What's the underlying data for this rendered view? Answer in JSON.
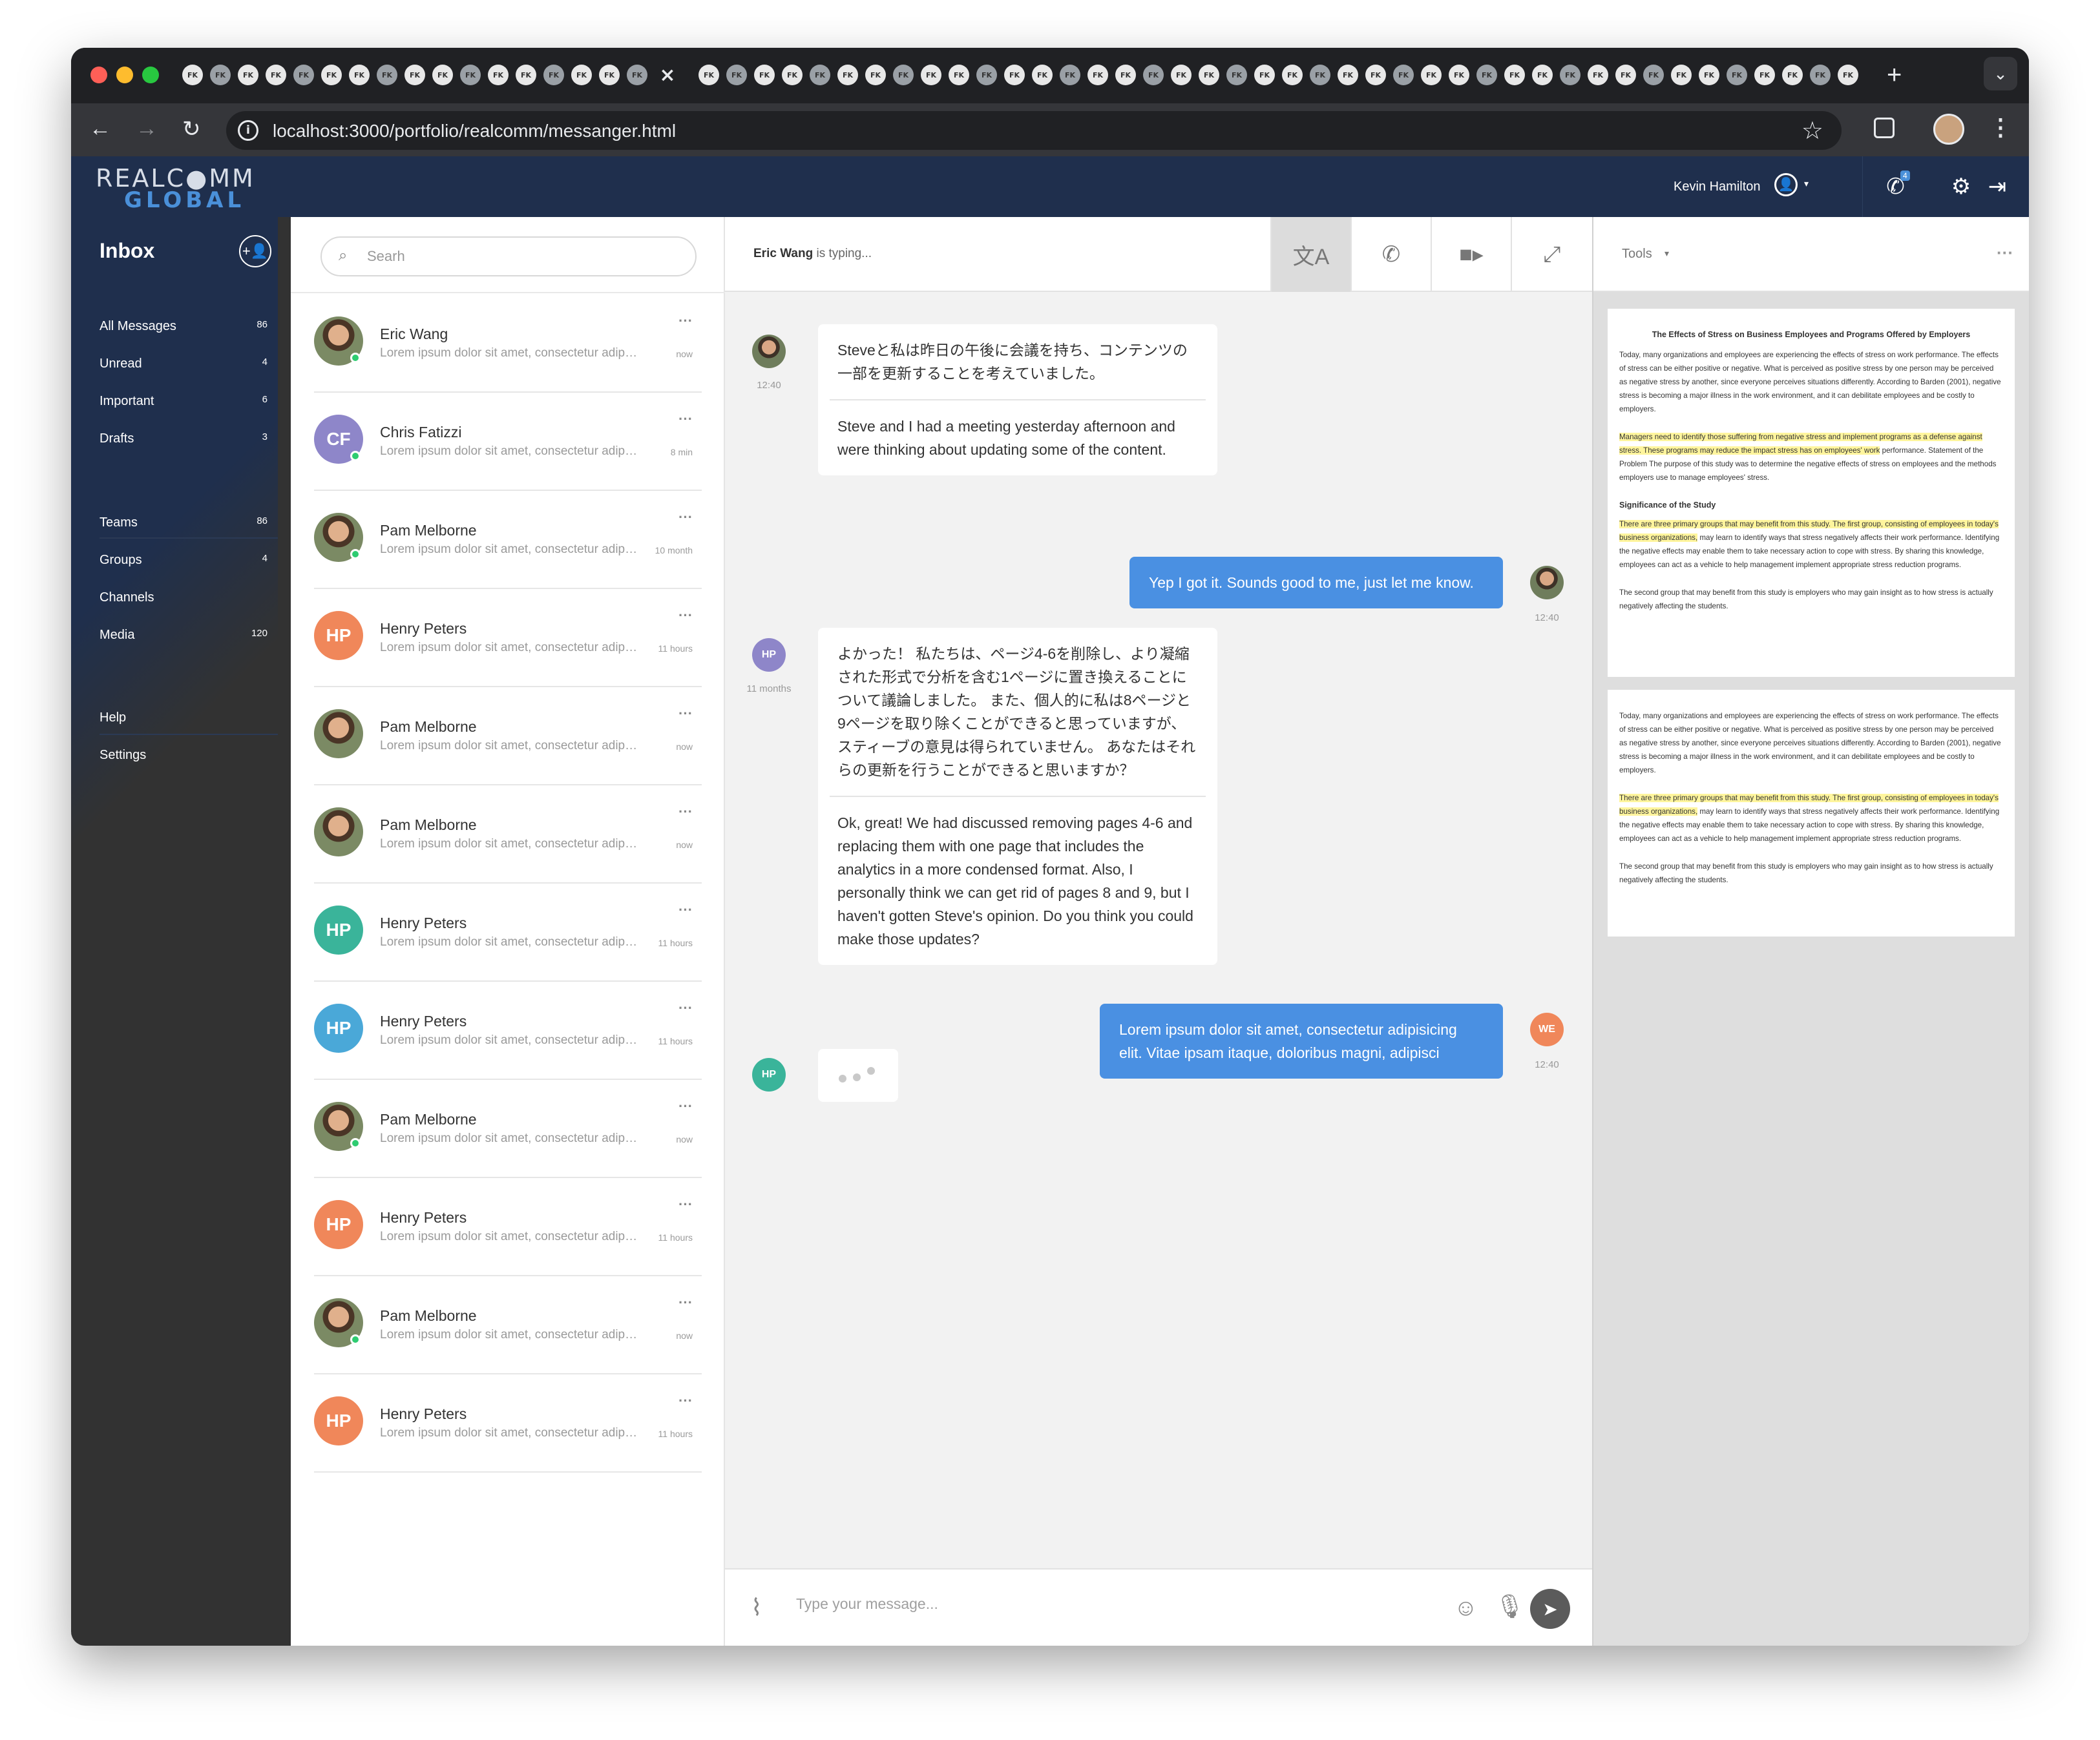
{
  "browser": {
    "url": "localhost:3000/portfolio/realcomm/messanger.html",
    "tab_label": "FK"
  },
  "header": {
    "logo_top": "REALC●MM",
    "logo_bottom": "GLOBAL",
    "user_name": "Kevin Hamilton",
    "notification_count": "4"
  },
  "sidebar": {
    "title": "Inbox",
    "items": [
      {
        "label": "All Messages",
        "count": "86"
      },
      {
        "label": "Unread",
        "count": "4"
      },
      {
        "label": "Important",
        "count": "6"
      },
      {
        "label": "Drafts",
        "count": "3"
      },
      {
        "label": "Teams",
        "count": "86"
      },
      {
        "label": "Groups",
        "count": "4"
      },
      {
        "label": "Channels",
        "count": ""
      },
      {
        "label": "Media",
        "count": "120"
      },
      {
        "label": "Help",
        "count": ""
      },
      {
        "label": "Settings",
        "count": ""
      }
    ]
  },
  "conversations": {
    "search_placeholder": "Searh",
    "items": [
      {
        "name": "Eric Wang",
        "preview": "Lorem ipsum dolor sit amet, consectetur adipisicing elit",
        "time": "now",
        "initials": "",
        "color": "",
        "online": true
      },
      {
        "name": "Chris Fatizzi",
        "preview": "Lorem ipsum dolor sit amet, consectetur adipisicing elit",
        "time": "8 min",
        "initials": "CF",
        "color": "#8e86c9",
        "online": true
      },
      {
        "name": "Pam Melborne",
        "preview": "Lorem ipsum dolor sit amet, consectetur adipisicing elit",
        "time": "10 month",
        "initials": "",
        "color": "",
        "online": true
      },
      {
        "name": "Henry Peters",
        "preview": "Lorem ipsum dolor sit amet, consectetur adipisicing elit",
        "time": "11 hours",
        "initials": "HP",
        "color": "#f0875a",
        "online": false
      },
      {
        "name": "Pam Melborne",
        "preview": "Lorem ipsum dolor sit amet, consectetur adipisicing elit",
        "time": "now",
        "initials": "",
        "color": "",
        "online": false
      },
      {
        "name": "Pam Melborne",
        "preview": "Lorem ipsum dolor sit amet, consectetur adipisicing elit",
        "time": "now",
        "initials": "",
        "color": "",
        "online": false
      },
      {
        "name": "Henry Peters",
        "preview": "Lorem ipsum dolor sit amet, consectetur adipisicing elit",
        "time": "11 hours",
        "initials": "HP",
        "color": "#3ab49a",
        "online": false
      },
      {
        "name": "Henry Peters",
        "preview": "Lorem ipsum dolor sit amet, consectetur adipisicing elit",
        "time": "11 hours",
        "initials": "HP",
        "color": "#4aa8d8",
        "online": false
      },
      {
        "name": "Pam Melborne",
        "preview": "Lorem ipsum dolor sit amet, consectetur adipisicing elit",
        "time": "now",
        "initials": "",
        "color": "",
        "online": true
      },
      {
        "name": "Henry Peters",
        "preview": "Lorem ipsum dolor sit amet, consectetur adipisicing elit",
        "time": "11 hours",
        "initials": "HP",
        "color": "#f0875a",
        "online": false
      },
      {
        "name": "Pam Melborne",
        "preview": "Lorem ipsum dolor sit amet, consectetur adipisicing elit",
        "time": "now",
        "initials": "",
        "color": "",
        "online": true
      },
      {
        "name": "Henry Peters",
        "preview": "Lorem ipsum dolor sit amet, consectetur adipisicing elit",
        "time": "11 hours",
        "initials": "HP",
        "color": "#f0875a",
        "online": false
      }
    ]
  },
  "chat": {
    "typing_name": "Eric Wang",
    "typing_suffix": " is typing...",
    "messages": [
      {
        "time": "12:40",
        "original": "Steveと私は昨日の午後に会議を持ち、コンテンツの一部を更新することを考えていました。",
        "translation": "Steve and I had a meeting yesterday afternoon and were thinking about updating some of the content."
      },
      {
        "time": "12:40",
        "text": "Yep I got it. Sounds good to me, just let me know."
      },
      {
        "time": "11 months",
        "initials": "HP",
        "original": "よかった！ 私たちは、ページ4-6を削除し、より凝縮された形式で分析を含む1ページに置き換えることについて議論しました。 また、個人的に私は8ページと9ページを取り除くことができると思っていますが、スティーブの意見は得られていません。 あなたはそれらの更新を行うことができると思いますか？",
        "translation": "Ok, great! We had discussed removing pages 4-6 and replacing them with one page that includes the analytics in a more condensed format. Also, I personally think we can get rid of pages 8 and 9, but I haven't gotten Steve's opinion. Do you think you could make those updates?"
      },
      {
        "time": "12:40",
        "initials": "WE",
        "text": "Lorem ipsum dolor sit amet, consectetur adipisicing elit. Vitae ipsam itaque, doloribus magni, adipisci"
      },
      {
        "initials": "HP"
      }
    ],
    "composer_placeholder": "Type your message..."
  },
  "tools": {
    "label": "Tools",
    "doc_title": "The Effects of Stress on Business Employees and Programs Offered by Employers",
    "p1": "Today, many organizations and employees are experiencing the effects of stress on work performance. The effects of stress can be either positive or negative. What is perceived as positive stress by one person may be perceived as negative stress by another, since everyone perceives situations differently. According to Barden (2001), negative stress is becoming a major illness in the work environment, and it can debilitate employees and be costly to employers.",
    "p2_highlight": "Managers need to identify those suffering from negative stress and implement programs as a defense against stress. These programs may reduce the impact stress has on employees' work",
    "p2_rest": " performance. Statement of the Problem The purpose of this study was to determine the negative effects of stress on employees and the methods employers use to manage employees' stress.",
    "subheading": "Significance of the Study",
    "p3_highlight": "There are three primary groups that may benefit from this study. The first group, consisting of employees in today's business organizations,",
    "p3_rest": " may learn to identify ways that stress negatively affects their work performance. Identifying the negative effects may enable them to take necessary action to cope with stress. By sharing this knowledge, employees can act as a vehicle to help management implement appropriate stress reduction programs.",
    "p4": "The second group that may benefit from this study is employers who may gain insight as to how stress is actually negatively affecting the students."
  }
}
